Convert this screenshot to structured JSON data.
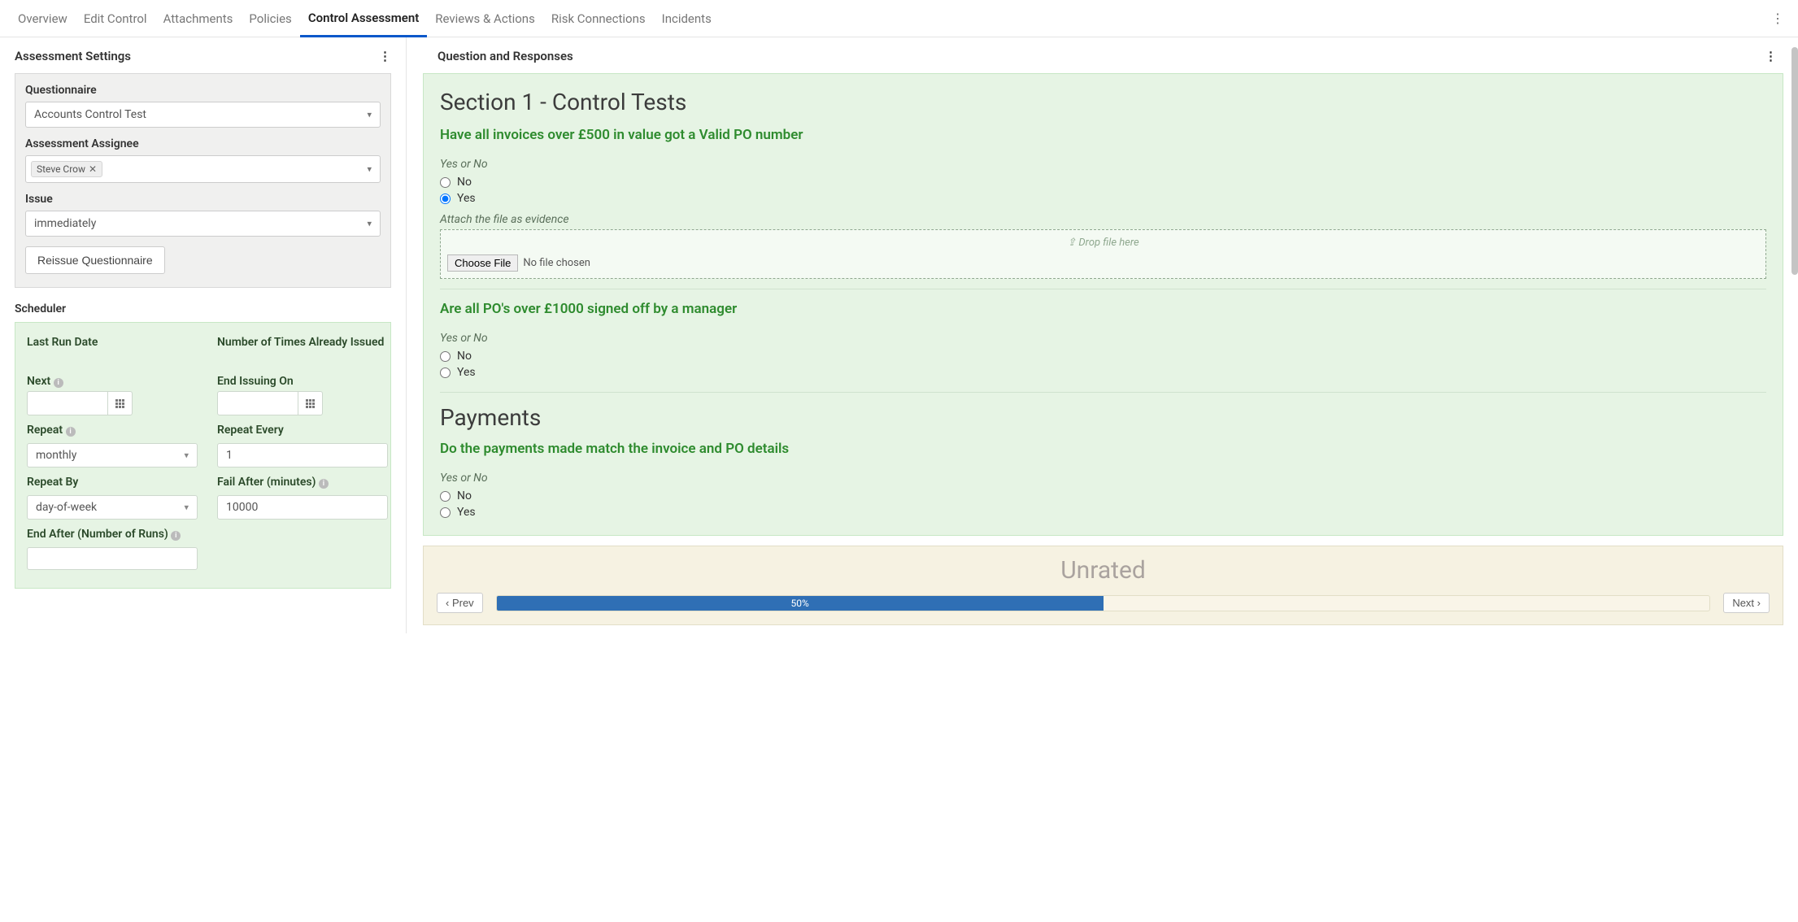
{
  "tabs": {
    "overview": "Overview",
    "edit_control": "Edit Control",
    "attachments": "Attachments",
    "policies": "Policies",
    "control_assessment": "Control Assessment",
    "reviews_actions": "Reviews & Actions",
    "risk_connections": "Risk Connections",
    "incidents": "Incidents"
  },
  "left": {
    "title": "Assessment Settings",
    "questionnaire_label": "Questionnaire",
    "questionnaire_value": "Accounts Control Test",
    "assignee_label": "Assessment Assignee",
    "assignee_chip": "Steve Crow",
    "issue_label": "Issue",
    "issue_value": "immediately",
    "reissue_btn": "Reissue Questionnaire",
    "scheduler_title": "Scheduler",
    "last_run_label": "Last Run Date",
    "issued_count_label": "Number of Times Already Issued",
    "next_label": "Next",
    "end_issuing_label": "End Issuing On",
    "repeat_label": "Repeat",
    "repeat_value": "monthly",
    "repeat_every_label": "Repeat Every",
    "repeat_every_value": "1",
    "repeat_by_label": "Repeat By",
    "repeat_by_value": "day-of-week",
    "fail_after_label": "Fail After (minutes)",
    "fail_after_value": "10000",
    "end_after_label": "End After (Number of Runs)"
  },
  "right": {
    "title": "Question and Responses",
    "section_title": "Section 1 - Control Tests",
    "q1_text": "Have all invoices over £500 in value got a Valid PO number",
    "yes_no_label": "Yes or No",
    "no_label": "No",
    "yes_label": "Yes",
    "attach_label": "Attach the file as evidence",
    "drop_hint": "⇪ Drop file here",
    "choose_file_btn": "Choose File",
    "no_file_chosen": "No file chosen",
    "q2_text": "Are all PO's over £1000 signed off by a manager",
    "payments_title": "Payments",
    "q3_text": "Do the payments made match the invoice and PO details",
    "unrated": "Unrated",
    "prev_btn": "Prev",
    "next_btn": "Next",
    "progress_pct": "50%"
  }
}
